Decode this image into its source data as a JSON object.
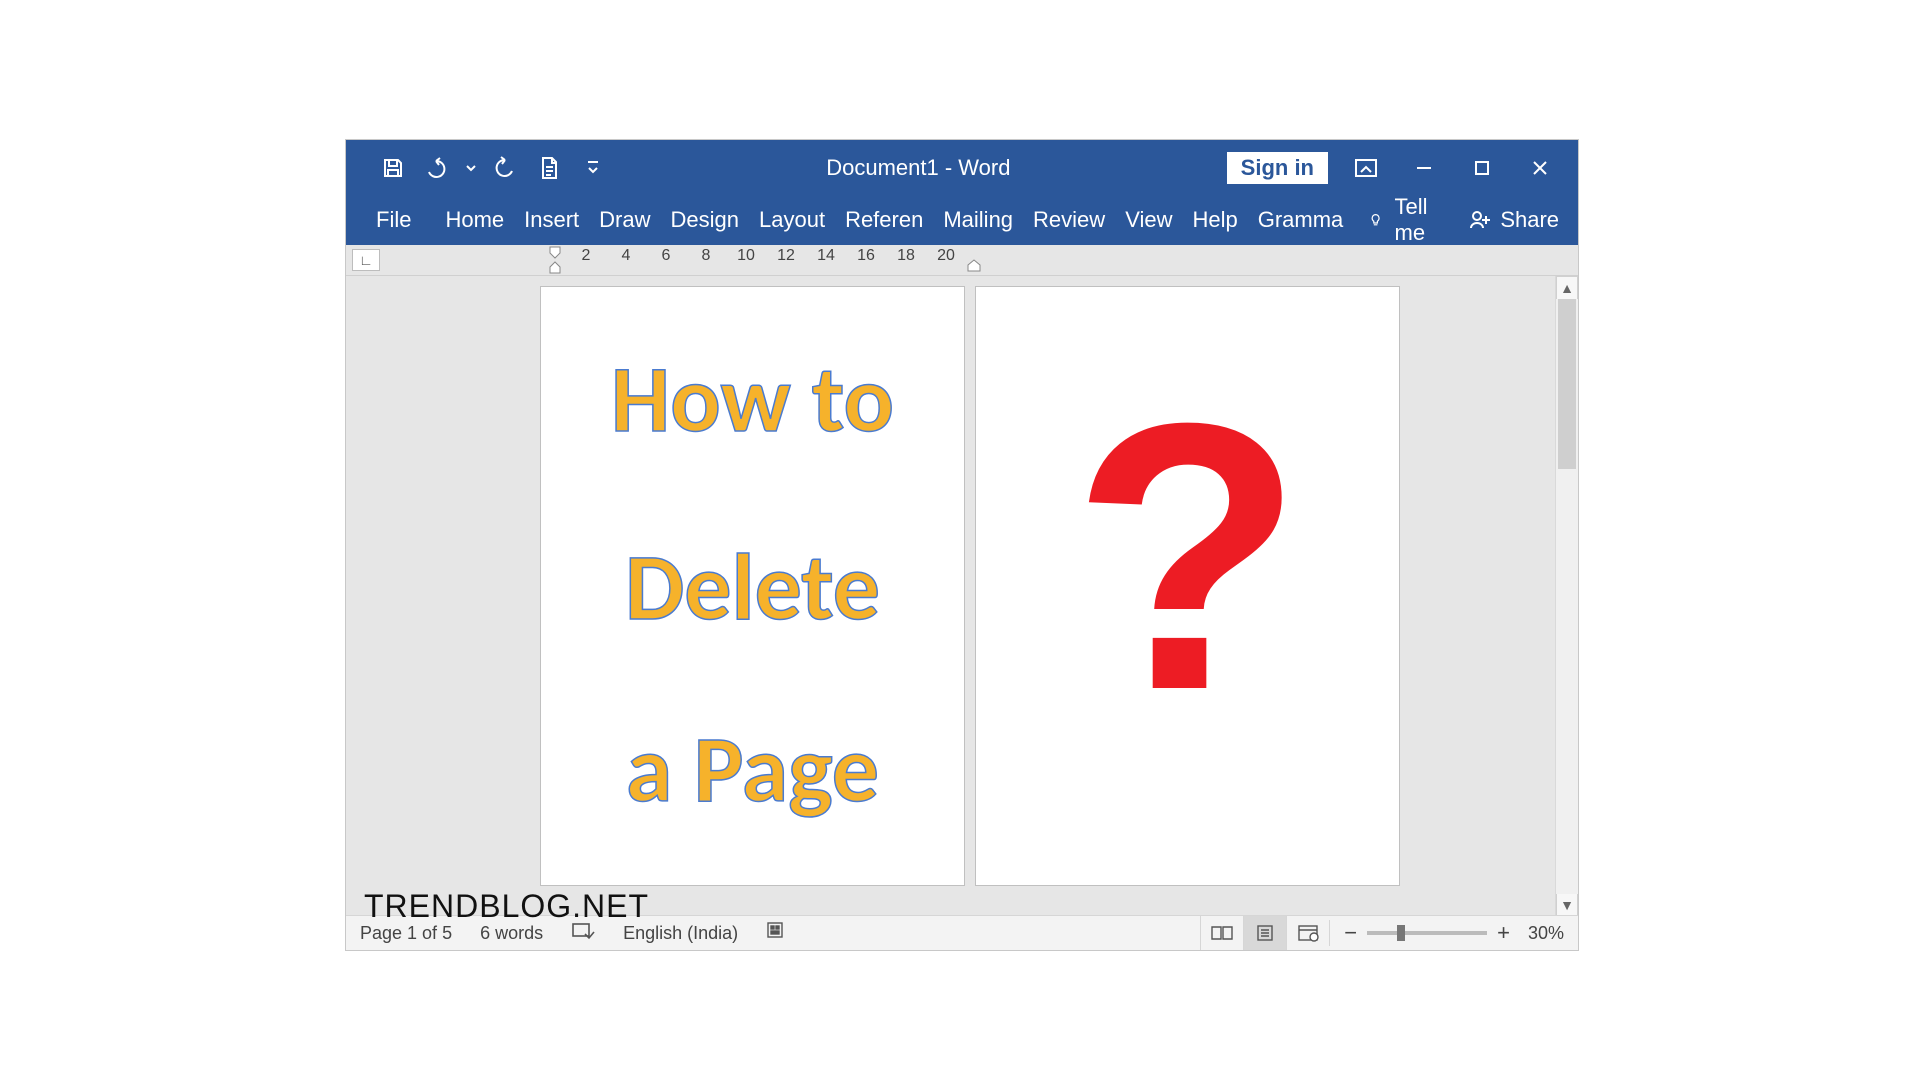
{
  "titlebar": {
    "doc_title": "Document1  -  Word",
    "signin": "Sign in"
  },
  "ribbon": {
    "file": "File",
    "tabs": [
      "Home",
      "Insert",
      "Draw",
      "Design",
      "Layout",
      "Referen",
      "Mailing",
      "Review",
      "View",
      "Help",
      "Gramma"
    ],
    "tellme": "Tell me",
    "share": "Share"
  },
  "ruler": {
    "marks": [
      "2",
      "4",
      "6",
      "8",
      "10",
      "12",
      "14",
      "16",
      "18",
      "20"
    ]
  },
  "document": {
    "page1_lines": [
      "How to",
      "Delete",
      "a Page"
    ],
    "page2": "?"
  },
  "status": {
    "page": "Page 1 of 5",
    "words": "6 words",
    "lang": "English (India)",
    "zoom": "30%"
  },
  "watermark": "TRENDBLOG.NET"
}
